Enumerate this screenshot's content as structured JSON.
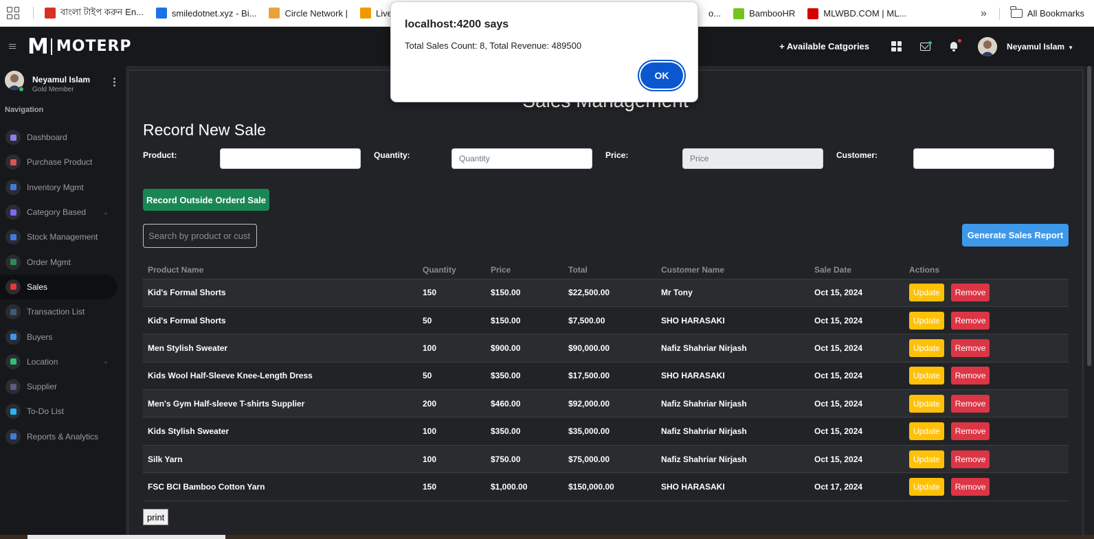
{
  "browser": {
    "bookmarks": [
      {
        "label": "বাংলা টাইপ করুন En...",
        "color": "#d93025"
      },
      {
        "label": "smiledotnet.xyz - Bi...",
        "color": "#1a73e8"
      },
      {
        "label": "Circle Network |",
        "color": "#e8a33d"
      },
      {
        "label": "Live TV",
        "color": "#f29900"
      },
      {
        "label": "",
        "color": "#0f9d58"
      }
    ],
    "bookmarks_right": [
      {
        "label": "o...",
        "color": "#ffffff"
      },
      {
        "label": "BambooHR",
        "color": "#73c41d"
      },
      {
        "label": "MLWBD.COM | ML...",
        "color": "#d50000"
      }
    ],
    "more": "»",
    "all_bookmarks": "All Bookmarks"
  },
  "header": {
    "logo_mark": "M",
    "logo_text": "MOTERP",
    "available_categories": "+ Available Catgories",
    "user_name": "Neyamul Islam",
    "mail_dot_color": "#2fbf71",
    "bell_dot_color": "#e53935"
  },
  "sidebar": {
    "user_name": "Neyamul Islam",
    "user_role": "Gold Member",
    "heading": "Navigation",
    "items": [
      {
        "label": "Dashboard",
        "icon": "gauge-icon",
        "color": "#8e7cf0"
      },
      {
        "label": "Purchase Product",
        "icon": "list-icon",
        "color": "#e05252"
      },
      {
        "label": "Inventory Mgmt",
        "icon": "inventory-icon",
        "color": "#3d7be0"
      },
      {
        "label": "Category Based",
        "icon": "category-icon",
        "color": "#7a6cf0",
        "chevron": "⌄"
      },
      {
        "label": "Stock Management",
        "icon": "stock-icon",
        "color": "#3d7be0"
      },
      {
        "label": "Order Mgmt",
        "icon": "layers-icon",
        "color": "#2e8b57"
      },
      {
        "label": "Sales",
        "icon": "bar-chart-icon",
        "color": "#e53935"
      },
      {
        "label": "Transaction List",
        "icon": "transaction-icon",
        "color": "#3d5a80"
      },
      {
        "label": "Buyers",
        "icon": "buyers-icon",
        "color": "#3d98e9"
      },
      {
        "label": "Location",
        "icon": "globe-icon",
        "color": "#2fbf71",
        "chevron": "⌄"
      },
      {
        "label": "Supplier",
        "icon": "supplier-icon",
        "color": "#5a5c80"
      },
      {
        "label": "To-Do List",
        "icon": "check-icon",
        "color": "#29b6f6"
      },
      {
        "label": "Reports & Analytics",
        "icon": "reports-icon",
        "color": "#3d7be0"
      }
    ]
  },
  "main": {
    "page_title": "Sales Management",
    "section_title": "Record New Sale",
    "form": {
      "product_label": "Product:",
      "product_value": "",
      "quantity_label": "Quantity:",
      "quantity_placeholder": "Quantity",
      "price_label": "Price:",
      "price_placeholder": "Price",
      "customer_label": "Customer:",
      "customer_value": ""
    },
    "record_outside_btn": "Record Outside Orderd Sale",
    "search_placeholder": "Search by product or cust",
    "generate_report_btn": "Generate Sales Report",
    "table": {
      "headers": [
        "Product Name",
        "Quantity",
        "Price",
        "Total",
        "Customer Name",
        "Sale Date",
        "Actions"
      ],
      "rows": [
        {
          "product": "Kid's Formal Shorts",
          "quantity": "150",
          "price": "$150.00",
          "total": "$22,500.00",
          "customer": "Mr Tony",
          "date": "Oct 15, 2024"
        },
        {
          "product": "Kid's Formal Shorts",
          "quantity": "50",
          "price": "$150.00",
          "total": "$7,500.00",
          "customer": "SHO HARASAKI",
          "date": "Oct 15, 2024"
        },
        {
          "product": "Men Stylish Sweater",
          "quantity": "100",
          "price": "$900.00",
          "total": "$90,000.00",
          "customer": "Nafiz Shahriar Nirjash",
          "date": "Oct 15, 2024"
        },
        {
          "product": "Kids Wool Half-Sleeve Knee-Length Dress",
          "quantity": "50",
          "price": "$350.00",
          "total": "$17,500.00",
          "customer": "SHO HARASAKI",
          "date": "Oct 15, 2024"
        },
        {
          "product": "Men's Gym Half-sleeve T-shirts Supplier",
          "quantity": "200",
          "price": "$460.00",
          "total": "$92,000.00",
          "customer": "Nafiz Shahriar Nirjash",
          "date": "Oct 15, 2024"
        },
        {
          "product": "Kids Stylish Sweater",
          "quantity": "100",
          "price": "$350.00",
          "total": "$35,000.00",
          "customer": "Nafiz Shahriar Nirjash",
          "date": "Oct 15, 2024"
        },
        {
          "product": "Silk Yarn",
          "quantity": "100",
          "price": "$750.00",
          "total": "$75,000.00",
          "customer": "Nafiz Shahriar Nirjash",
          "date": "Oct 15, 2024"
        },
        {
          "product": "FSC BCI Bamboo Cotton Yarn",
          "quantity": "150",
          "price": "$1,000.00",
          "total": "$150,000.00",
          "customer": "SHO HARASAKI",
          "date": "Oct 17, 2024"
        }
      ],
      "update_label": "Update",
      "remove_label": "Remove"
    },
    "print_btn": "print"
  },
  "dialog": {
    "title": "localhost:4200 says",
    "message": "Total Sales Count: 8, Total Revenue: 489500",
    "ok_label": "OK"
  }
}
